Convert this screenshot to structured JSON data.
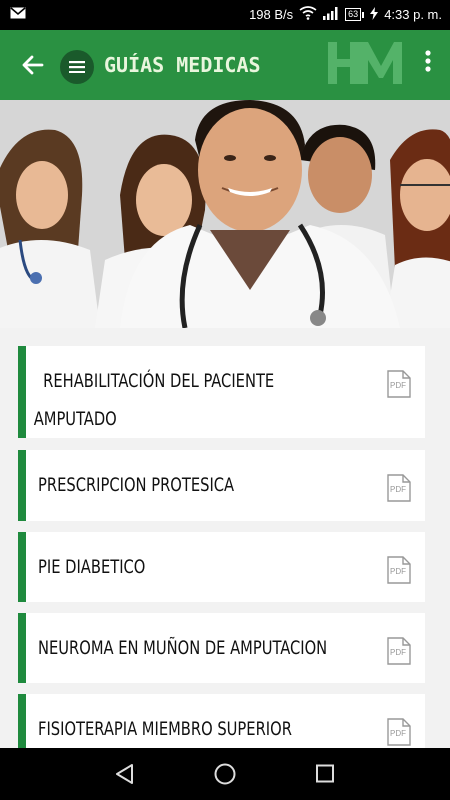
{
  "status_bar": {
    "speed": "198 B/s",
    "battery": "63",
    "time": "4:33 p. m."
  },
  "app_bar": {
    "title": "GUÍAS MEDICAS",
    "logo_text": "HM"
  },
  "guides": [
    {
      "line1": "REHABILITACIÓN DEL PACIENTE",
      "line2": "AMPUTADO",
      "icon": "pdf-icon"
    },
    {
      "line1": "PRESCRIPCION PROTESICA",
      "line2": "",
      "icon": "pdf-icon"
    },
    {
      "line1": "PIE DIABETICO",
      "line2": "",
      "icon": "pdf-icon"
    },
    {
      "line1": "NEUROMA EN MUÑON DE AMPUTACION",
      "line2": "",
      "icon": "pdf-icon"
    },
    {
      "line1": "FISIOTERAPIA MIEMBRO SUPERIOR",
      "line2": "",
      "icon": "pdf-icon"
    }
  ],
  "pdf_label": "PDF",
  "colors": {
    "app_bar": "#2a9142",
    "accent": "#1f8a3e",
    "menu_circle": "#1a5a2b",
    "title_text": "#e9f6dd"
  }
}
